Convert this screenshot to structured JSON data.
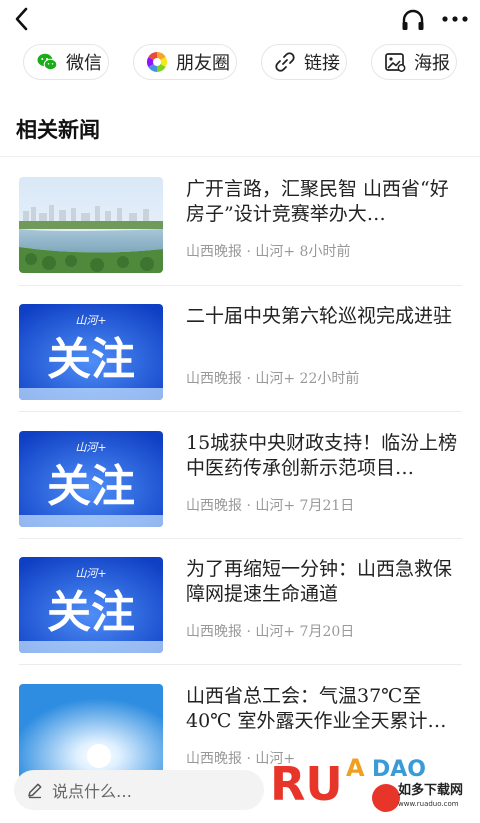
{
  "share": {
    "wechat": "微信",
    "moments": "朋友圈",
    "link": "链接",
    "poster": "海报"
  },
  "section_title": "相关新闻",
  "news": [
    {
      "title": "广开言路，汇聚民智 山西省“好房子”设计竞赛举办大…",
      "meta": "山西晚报 · 山河+ 8小时前",
      "thumb": "city-lake-photo"
    },
    {
      "title": "二十届中央第六轮巡视完成进驻",
      "meta": "山西晚报 · 山河+ 22小时前",
      "thumb": "guanzhu-banner",
      "thumb_text": "关注",
      "thumb_logo": "山河+"
    },
    {
      "title": "15城获中央财政支持！临汾上榜中医药传承创新示范项目…",
      "meta": "山西晚报 · 山河+ 7月21日",
      "thumb": "guanzhu-banner",
      "thumb_text": "关注",
      "thumb_logo": "山河+"
    },
    {
      "title": "为了再缩短一分钟：山西急救保障网提速生命通道",
      "meta": "山西晚报 · 山河+ 7月20日",
      "thumb": "guanzhu-banner",
      "thumb_text": "关注",
      "thumb_logo": "山河+"
    },
    {
      "title": "山西省总工会：气温37℃至40℃ 室外露天作业全天累计…",
      "meta": "山西晚报 · 山河+",
      "thumb": "sun-sky-photo"
    }
  ],
  "comment_placeholder": "说点什么…",
  "watermark": {
    "brand": "RUANDAO",
    "sub": "如多下载网",
    "url": "www.ruaduo.com"
  },
  "colors": {
    "wechat": "#1aad19",
    "banner_blue": "#1550d8",
    "meta_gray": "#999999"
  }
}
